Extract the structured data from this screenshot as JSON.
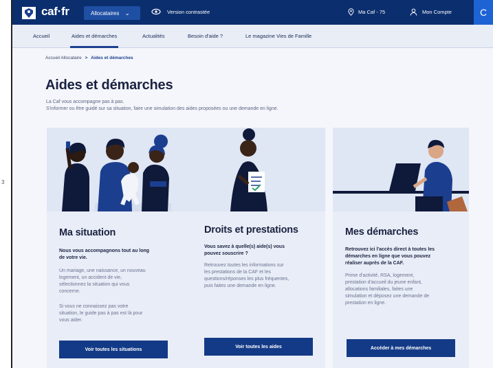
{
  "header": {
    "logo_text": "caf·fr",
    "allocataires_label": "Allocataires",
    "contrast_label": "Version contrastée",
    "macaf_label": "Ma Caf - 75",
    "account_label": "Mon Compte"
  },
  "subnav": {
    "items": [
      "Accueil",
      "Aides et démarches",
      "Actualités",
      "Besoin d'aide ?",
      "Le magazine Vies de Famille"
    ]
  },
  "breadcrumb": {
    "root": "Accueil Allocataire",
    "separator": ">",
    "current": "Aides et démarches"
  },
  "page": {
    "title": "Aides et démarches",
    "intro_line1": "La Caf vous accompagne pas à pas.",
    "intro_line2": "S'informer ou être guidé sur sa situation, faire une simulation des aides proposées ou une demande en ligne."
  },
  "cards": [
    {
      "title": "Ma situation",
      "lead_lines": [
        "Nous vous accompagnons tout au long",
        "de votre vie."
      ],
      "body1_lines": [
        "Un mariage, une naissance, un nouveau",
        "logement, un accident de vie,",
        "sélectionnez la situation qui vous",
        "concerne."
      ],
      "body2_lines": [
        "Si vous ne connaissez pas votre",
        "situation, le guide pas à pas est là pour",
        "vous aider."
      ],
      "button": "Voir toutes les situations"
    },
    {
      "title": "Droits et prestations",
      "lead_lines": [
        "Vous savez à quelle(s) aide(s) vous",
        "pouvez souscrire ?"
      ],
      "body1_lines": [
        "Retrouvez toutes les informations sur",
        "les prestations de la CAF et les",
        "questions/réponses les plus fréquentes,",
        "puis faites une demande en ligne."
      ],
      "button": "Voir toutes les aides"
    },
    {
      "title": "Mes démarches",
      "lead_lines": [
        "Retrouvez ici l'accès direct à toutes les",
        "démarches en ligne que vous pouvez",
        "réaliser auprès de la CAF."
      ],
      "body1_lines": [
        "Prime d'activité, RSA, logement,",
        "prestation d'accueil du jeune enfant,",
        "allocations familiales, faites une",
        "simulation et déposez une demande de",
        "prestation en ligne."
      ],
      "button": "Accéder à mes démarches"
    }
  ],
  "colors": {
    "brand_dark": "#0b2e6e",
    "brand_button": "#133a86",
    "accent_blue": "#1e63d4",
    "card_bg": "#e9edf7"
  },
  "icons": [
    "caf-logo-icon",
    "chevron-down-icon",
    "eye-icon",
    "location-pin-icon",
    "user-icon",
    "search-icon"
  ]
}
